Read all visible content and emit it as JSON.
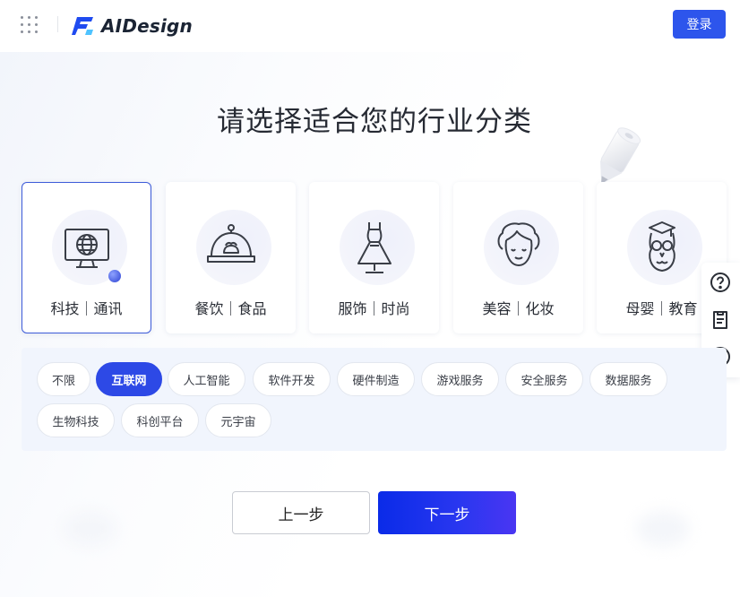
{
  "header": {
    "logo_text": "AIDesign",
    "login_label": "登录",
    "icons": {
      "apps": "grid-dots-icon",
      "logo": "aidesign-logo-icon"
    }
  },
  "page": {
    "title": "请选择适合您的行业分类"
  },
  "categories": [
    {
      "label": "科技｜通讯",
      "icon": "computer-globe-icon",
      "selected": true
    },
    {
      "label": "餐饮｜食品",
      "icon": "food-cloche-icon",
      "selected": false
    },
    {
      "label": "服饰｜时尚",
      "icon": "dress-mannequin-icon",
      "selected": false
    },
    {
      "label": "美容｜化妆",
      "icon": "woman-face-icon",
      "selected": false
    },
    {
      "label": "母婴｜教育",
      "icon": "owl-graduate-icon",
      "selected": false
    }
  ],
  "subcategories": [
    {
      "label": "不限",
      "active": false
    },
    {
      "label": "互联网",
      "active": true
    },
    {
      "label": "人工智能",
      "active": false
    },
    {
      "label": "软件开发",
      "active": false
    },
    {
      "label": "硬件制造",
      "active": false
    },
    {
      "label": "游戏服务",
      "active": false
    },
    {
      "label": "安全服务",
      "active": false
    },
    {
      "label": "数据服务",
      "active": false
    },
    {
      "label": "生物科技",
      "active": false
    },
    {
      "label": "科创平台",
      "active": false
    },
    {
      "label": "元宇宙",
      "active": false
    }
  ],
  "tools": [
    "help-icon",
    "document-icon",
    "smile-feedback-icon"
  ],
  "buttons": {
    "prev": "上一步",
    "next": "下一步"
  },
  "colors": {
    "primary": "#2d55ec",
    "active_tag": "#2d49e6",
    "panel_bg": "#f1f5fd"
  }
}
